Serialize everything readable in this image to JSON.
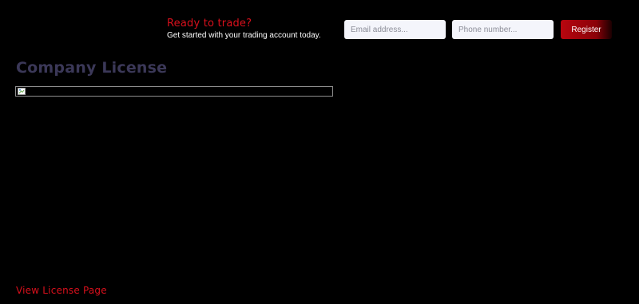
{
  "cta": {
    "title": "Ready to trade?",
    "subtitle": "Get started with your trading account today.",
    "email_placeholder": "Email address...",
    "phone_placeholder": "Phone number...",
    "register_label": "Register"
  },
  "main": {
    "title": "Company License",
    "image_icon": "broken-image-icon",
    "link_label": "View License Page"
  },
  "colors": {
    "background": "#000000",
    "accent": "#d9101c",
    "title": "#3b3858",
    "input_bg": "#f4f5fb"
  }
}
